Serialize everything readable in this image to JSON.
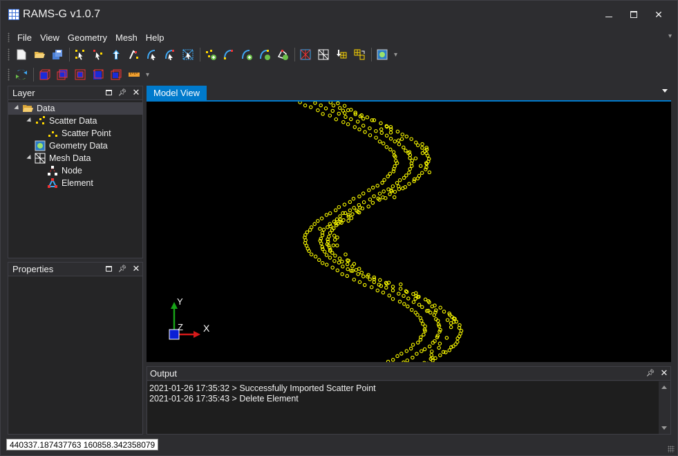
{
  "window": {
    "title": "RAMS-G v1.0.7",
    "controls": [
      "minimize",
      "maximize",
      "close"
    ]
  },
  "menu": {
    "items": [
      "File",
      "View",
      "Geometry",
      "Mesh",
      "Help"
    ]
  },
  "toolbar1": {
    "groups": [
      [
        "new-file-icon",
        "open-folder-icon",
        "save-icon"
      ],
      [
        "select-point-icon",
        "select-point-add-icon",
        "move-point-icon",
        "pick-point-icon",
        "select-line-icon",
        "select-line-add-icon",
        "box-select-icon"
      ],
      [
        "scatter-add-icon",
        "line-point-icon",
        "curve-add-icon",
        "curve-point-icon",
        "polygon-point-icon"
      ],
      [
        "mesh-generate-icon",
        "mesh-grid-icon",
        "mesh-import-icon",
        "mesh-export-icon"
      ],
      [
        "geometry-view-icon"
      ]
    ]
  },
  "toolbar2": {
    "icons": [
      "refresh-icon",
      "cube-solid-icon",
      "cube-front-icon",
      "cube-side-icon",
      "cube-wire-icon",
      "cube-outline-icon",
      "ruler-icon"
    ]
  },
  "layer_panel": {
    "title": "Layer",
    "tree": [
      {
        "label": "Data",
        "level": 0,
        "icon": "folder-open-icon",
        "expanded": true,
        "selected": true
      },
      {
        "label": "Scatter Data",
        "level": 1,
        "icon": "scatter-data-icon",
        "expanded": true
      },
      {
        "label": "Scatter Point",
        "level": 2,
        "icon": "scatter-point-icon"
      },
      {
        "label": "Geometry Data",
        "level": 1,
        "icon": "geometry-data-icon"
      },
      {
        "label": "Mesh Data",
        "level": 1,
        "icon": "mesh-data-icon",
        "expanded": true
      },
      {
        "label": "Node",
        "level": 2,
        "icon": "node-icon"
      },
      {
        "label": "Element",
        "level": 2,
        "icon": "element-icon"
      }
    ]
  },
  "properties_panel": {
    "title": "Properties"
  },
  "model_view": {
    "tab_label": "Model View",
    "axis_labels": {
      "y": "Y",
      "z": "Z",
      "x": "X"
    },
    "point_color": "#ffff00"
  },
  "output_panel": {
    "title": "Output",
    "lines": [
      "2021-01-26 17:35:32 > Successfully Imported Scatter Point",
      "2021-01-26 17:35:43 > Delete Element"
    ]
  },
  "status": {
    "coordinates": "440337.187437763  160858.342358079"
  },
  "colors": {
    "accent": "#007acc",
    "background": "#2d2d30",
    "panel": "#252526",
    "viewport": "#000000"
  }
}
